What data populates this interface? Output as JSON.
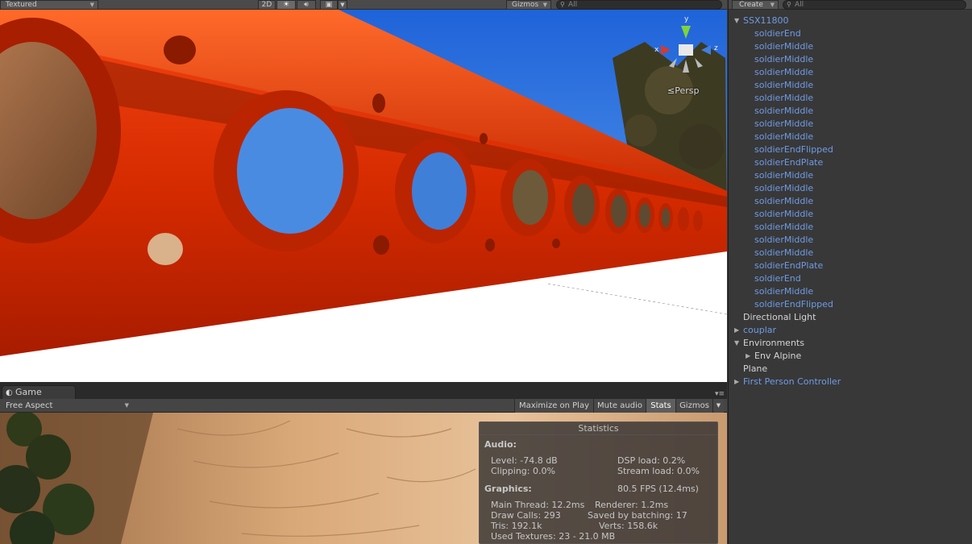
{
  "scene": {
    "render_mode": "Textured",
    "btn_2d": "2D",
    "lighting_icon": "sun-icon",
    "audio_icon": "speaker-icon",
    "effects_icon": "image-icon",
    "gizmos_label": "Gizmos",
    "search_placeholder": "All",
    "persp_label": "Persp",
    "axis_x": "x",
    "axis_z": "z",
    "axis_y": "y"
  },
  "game": {
    "tab_label": "Game",
    "aspect": "Free Aspect",
    "buttons": {
      "maximize": "Maximize on Play",
      "mute": "Mute audio",
      "stats": "Stats",
      "gizmos": "Gizmos"
    },
    "stats": {
      "title": "Statistics",
      "audio_heading": "Audio:",
      "level": "Level: -74.8 dB",
      "clipping": "Clipping: 0.0%",
      "dsp_load": "DSP load: 0.2%",
      "stream_load": "Stream load: 0.0%",
      "graphics_heading": "Graphics:",
      "fps": "80.5 FPS (12.4ms)",
      "main_thread": "Main Thread: 12.2ms",
      "renderer": "Renderer: 1.2ms",
      "draw_calls": "Draw Calls: 293",
      "saved_batching": "Saved by batching: 17",
      "tris": "Tris: 192.1k",
      "verts": "Verts: 158.6k",
      "used_textures": "Used Textures: 23 - 21.0 MB"
    }
  },
  "hierarchy": {
    "create_label": "Create",
    "search_placeholder": "All",
    "items": [
      {
        "label": "SSX11800",
        "indent": 0,
        "toggle": "expanded",
        "prefab": true
      },
      {
        "label": "soldierEnd",
        "indent": 1,
        "toggle": "none",
        "prefab": true
      },
      {
        "label": "soldierMiddle",
        "indent": 1,
        "toggle": "none",
        "prefab": true
      },
      {
        "label": "soldierMiddle",
        "indent": 1,
        "toggle": "none",
        "prefab": true
      },
      {
        "label": "soldierMiddle",
        "indent": 1,
        "toggle": "none",
        "prefab": true
      },
      {
        "label": "soldierMiddle",
        "indent": 1,
        "toggle": "none",
        "prefab": true
      },
      {
        "label": "soldierMiddle",
        "indent": 1,
        "toggle": "none",
        "prefab": true
      },
      {
        "label": "soldierMiddle",
        "indent": 1,
        "toggle": "none",
        "prefab": true
      },
      {
        "label": "soldierMiddle",
        "indent": 1,
        "toggle": "none",
        "prefab": true
      },
      {
        "label": "soldierMiddle",
        "indent": 1,
        "toggle": "none",
        "prefab": true
      },
      {
        "label": "soldierEndFlipped",
        "indent": 1,
        "toggle": "none",
        "prefab": true
      },
      {
        "label": "soldierEndPlate",
        "indent": 1,
        "toggle": "none",
        "prefab": true
      },
      {
        "label": "soldierMiddle",
        "indent": 1,
        "toggle": "none",
        "prefab": true
      },
      {
        "label": "soldierMiddle",
        "indent": 1,
        "toggle": "none",
        "prefab": true
      },
      {
        "label": "soldierMiddle",
        "indent": 1,
        "toggle": "none",
        "prefab": true
      },
      {
        "label": "soldierMiddle",
        "indent": 1,
        "toggle": "none",
        "prefab": true
      },
      {
        "label": "soldierMiddle",
        "indent": 1,
        "toggle": "none",
        "prefab": true
      },
      {
        "label": "soldierMiddle",
        "indent": 1,
        "toggle": "none",
        "prefab": true
      },
      {
        "label": "soldierMiddle",
        "indent": 1,
        "toggle": "none",
        "prefab": true
      },
      {
        "label": "soldierEndPlate",
        "indent": 1,
        "toggle": "none",
        "prefab": true
      },
      {
        "label": "soldierEnd",
        "indent": 1,
        "toggle": "none",
        "prefab": true
      },
      {
        "label": "soldierMiddle",
        "indent": 1,
        "toggle": "none",
        "prefab": true
      },
      {
        "label": "soldierEndFlipped",
        "indent": 1,
        "toggle": "none",
        "prefab": true
      },
      {
        "label": "Directional Light",
        "indent": 0,
        "toggle": "none",
        "prefab": false
      },
      {
        "label": "couplar",
        "indent": 0,
        "toggle": "collapsed",
        "prefab": true
      },
      {
        "label": "Environments",
        "indent": 0,
        "toggle": "expanded",
        "prefab": false
      },
      {
        "label": "Env Alpine",
        "indent": 1,
        "toggle": "collapsed",
        "prefab": false
      },
      {
        "label": "Plane",
        "indent": 0,
        "toggle": "none",
        "prefab": false
      },
      {
        "label": "First Person Controller",
        "indent": 0,
        "toggle": "collapsed",
        "prefab": true
      }
    ]
  },
  "colors": {
    "prefab_text": "#6f9be6",
    "beam_red": "#d42a00",
    "panel_bg": "#383838"
  }
}
